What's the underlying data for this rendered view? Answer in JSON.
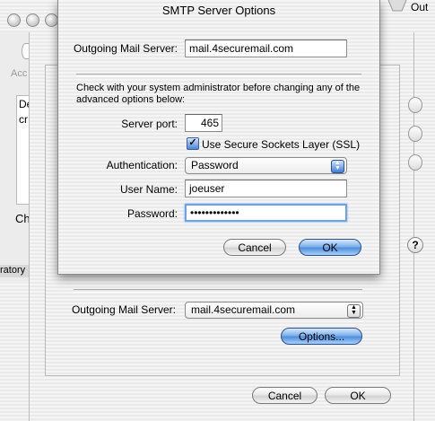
{
  "back_window": {
    "partial_toolbar_label": "Acc",
    "list_header": "De",
    "list_row": "cr",
    "change_label_partial": "Ch",
    "top_right_label": "Out",
    "left_edge_text": "ratory",
    "help_glyph": "?",
    "outgoing_label": "Outgoing Mail Server:",
    "outgoing_value": "mail.4securemail.com",
    "options_button": "Options...",
    "cancel_button": "Cancel",
    "ok_button": "OK"
  },
  "dialog": {
    "title": "SMTP Server Options",
    "outgoing_label": "Outgoing Mail Server:",
    "outgoing_value": "mail.4securemail.com",
    "advisory_text": "Check with your system administrator before changing any of the advanced options below:",
    "server_port_label": "Server port:",
    "server_port_value": "465",
    "ssl_label": "Use Secure Sockets Layer (SSL)",
    "ssl_checked": true,
    "authentication_label": "Authentication:",
    "authentication_value": "Password",
    "username_label": "User Name:",
    "username_value": "joeuser",
    "password_label": "Password:",
    "password_mask": "•••••••••••••",
    "cancel_button": "Cancel",
    "ok_button": "OK"
  },
  "colors": {
    "accent_blue": "#4e8fdc",
    "focus_ring": "#6fa3e8"
  }
}
